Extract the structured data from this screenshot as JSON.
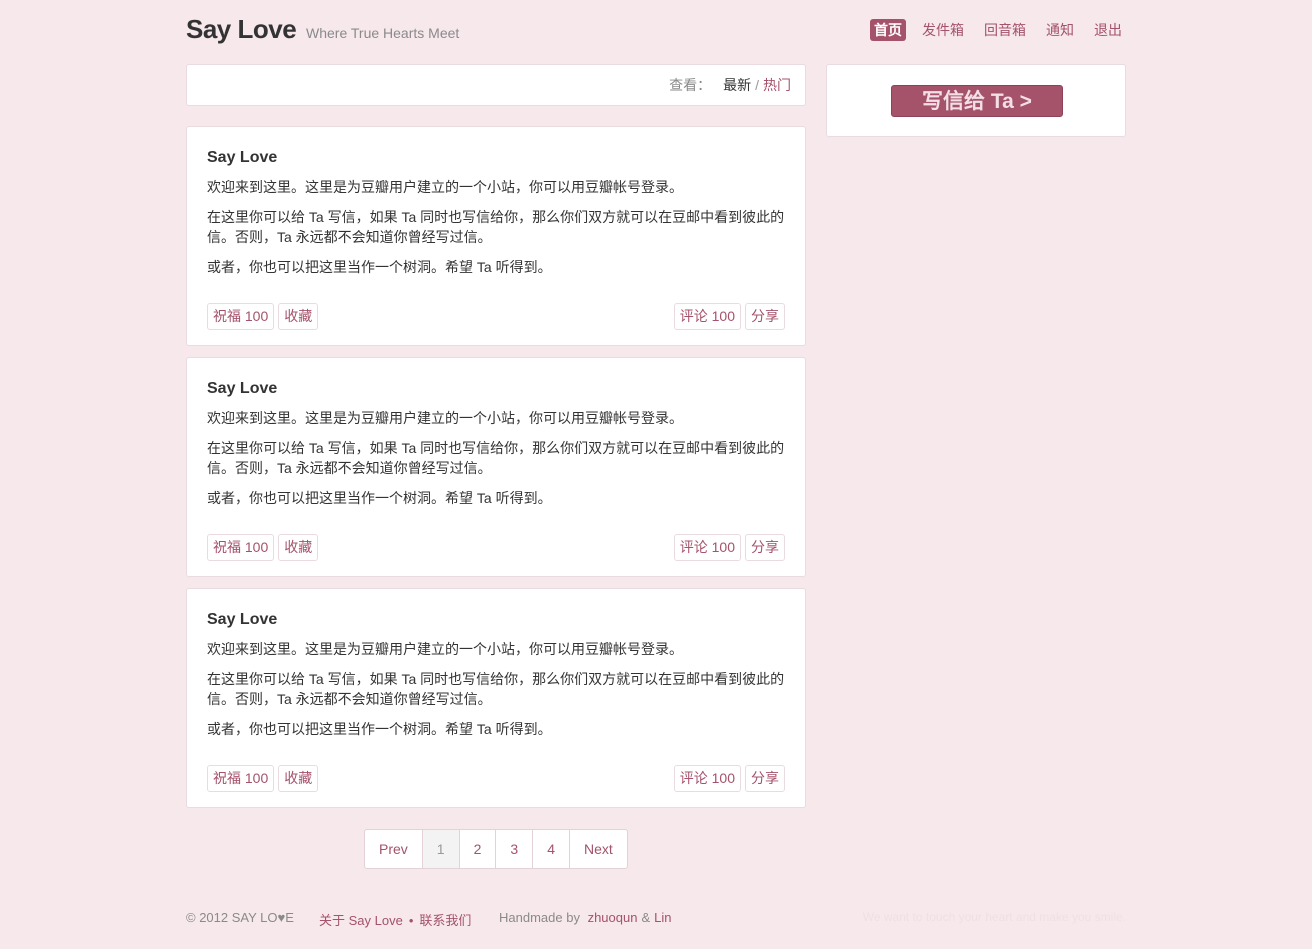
{
  "header": {
    "title": "Say Love",
    "tagline": "Where True Hearts Meet",
    "nav": [
      {
        "label": "首页",
        "active": true
      },
      {
        "label": "发件箱"
      },
      {
        "label": "回音箱"
      },
      {
        "label": "通知"
      },
      {
        "label": "退出"
      }
    ]
  },
  "filter": {
    "label": "查看：",
    "current": "最新",
    "separator": "/",
    "other": "热门"
  },
  "sidebar": {
    "write_button": "写信给 Ta >"
  },
  "posts": [
    {
      "title": "Say Love",
      "paragraphs": [
        "欢迎来到这里。这里是为豆瓣用户建立的一个小站，你可以用豆瓣帐号登录。",
        "在这里你可以给 Ta 写信，如果 Ta 同时也写信给你，那么你们双方就可以在豆邮中看到彼此的信。否则，Ta 永远都不会知道你曾经写过信。",
        "或者，你也可以把这里当作一个树洞。希望 Ta 听得到。"
      ],
      "bless": "祝福 100",
      "collect": "收藏",
      "comment": "评论 100",
      "share": "分享"
    },
    {
      "title": "Say Love",
      "paragraphs": [
        "欢迎来到这里。这里是为豆瓣用户建立的一个小站，你可以用豆瓣帐号登录。",
        "在这里你可以给 Ta 写信，如果 Ta 同时也写信给你，那么你们双方就可以在豆邮中看到彼此的信。否则，Ta 永远都不会知道你曾经写过信。",
        "或者，你也可以把这里当作一个树洞。希望 Ta 听得到。"
      ],
      "bless": "祝福 100",
      "collect": "收藏",
      "comment": "评论 100",
      "share": "分享"
    },
    {
      "title": "Say Love",
      "paragraphs": [
        "欢迎来到这里。这里是为豆瓣用户建立的一个小站，你可以用豆瓣帐号登录。",
        "在这里你可以给 Ta 写信，如果 Ta 同时也写信给你，那么你们双方就可以在豆邮中看到彼此的信。否则，Ta 永远都不会知道你曾经写过信。",
        "或者，你也可以把这里当作一个树洞。希望 Ta 听得到。"
      ],
      "bless": "祝福 100",
      "collect": "收藏",
      "comment": "评论 100",
      "share": "分享"
    }
  ],
  "pagination": {
    "prev": "Prev",
    "pages": [
      "1",
      "2",
      "3",
      "4"
    ],
    "current": "1",
    "next": "Next"
  },
  "footer": {
    "copyright": "© 2012 SAY LO♥E",
    "about": "关于 Say Love",
    "dot": "•",
    "contact": "联系我们",
    "handmade": "Handmade by",
    "author1": "zhuoqun",
    "amp": "&",
    "author2": "Lin",
    "slogan": "We want to touch your heart and make you smile."
  },
  "colors": {
    "accent": "#a4536b",
    "background": "#f7e8ec",
    "card": "#ffffff"
  }
}
